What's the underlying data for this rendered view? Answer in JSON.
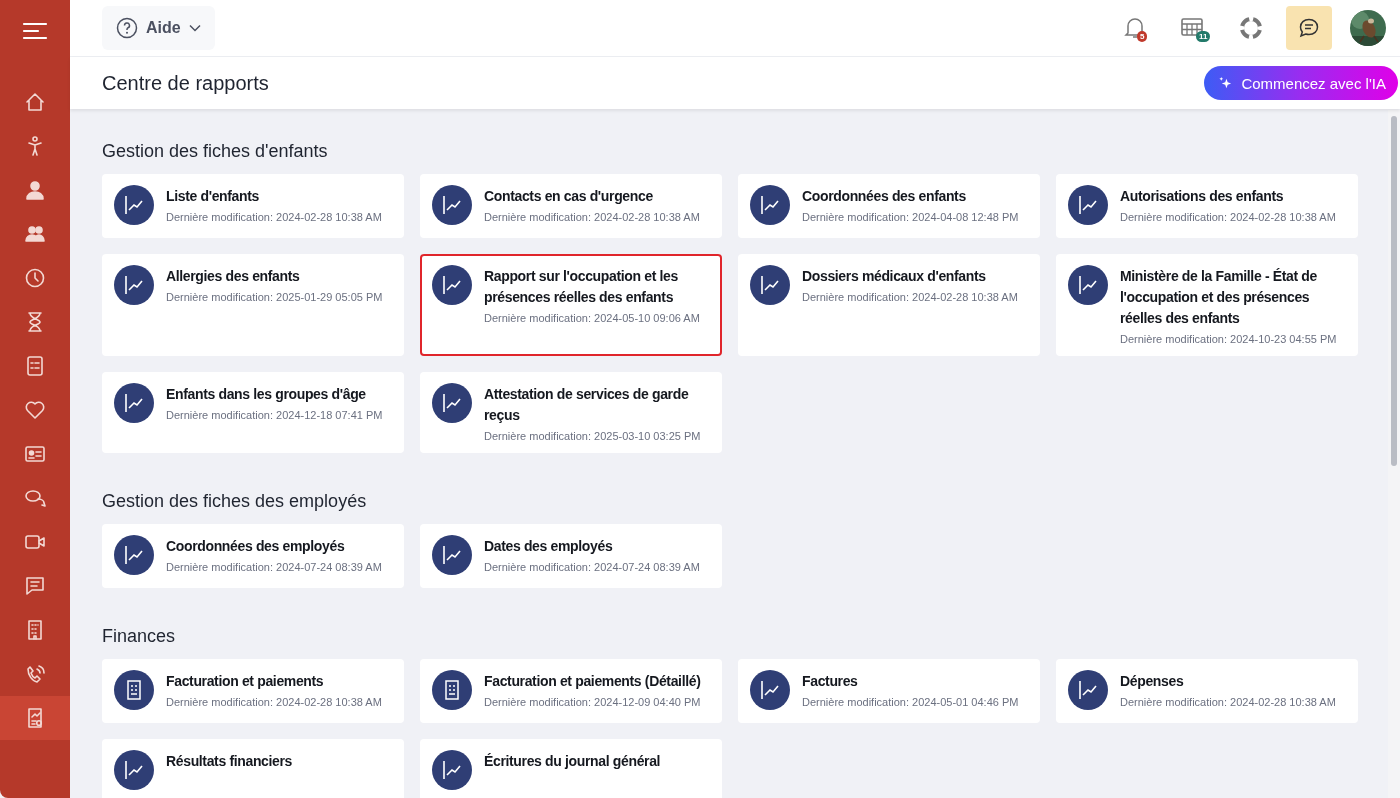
{
  "sidebar": {
    "items": [
      {
        "selected": false
      },
      {
        "selected": false
      },
      {
        "selected": false
      },
      {
        "selected": false
      },
      {
        "selected": false
      },
      {
        "selected": false
      },
      {
        "selected": false
      },
      {
        "selected": false
      },
      {
        "selected": false
      },
      {
        "selected": false
      },
      {
        "selected": false
      },
      {
        "selected": false
      },
      {
        "selected": false
      },
      {
        "selected": false
      },
      {
        "selected": true
      }
    ]
  },
  "topbar": {
    "help_label": "Aide",
    "notifications_badge": "5",
    "schedule_badge": "11",
    "chat_active": true
  },
  "page_title": "Centre de rapports",
  "ai_button": "Commencez avec l'IA",
  "sections": [
    {
      "title": "Gestion des fiches d'enfants",
      "cards": [
        {
          "title": "Liste d'enfants",
          "meta": "Dernière modification: 2024-02-28 10:38 AM",
          "kind": "chart",
          "highlighted": false
        },
        {
          "title": "Contacts en cas d'urgence",
          "meta": "Dernière modification: 2024-02-28 10:38 AM",
          "kind": "chart",
          "highlighted": false
        },
        {
          "title": "Coordonnées des enfants",
          "meta": "Dernière modification: 2024-04-08 12:48 PM",
          "kind": "chart",
          "highlighted": false
        },
        {
          "title": "Autorisations des enfants",
          "meta": "Dernière modification: 2024-02-28 10:38 AM",
          "kind": "chart",
          "highlighted": false
        },
        {
          "title": "Allergies des enfants",
          "meta": "Dernière modification: 2025-01-29 05:05 PM",
          "kind": "chart",
          "highlighted": false
        },
        {
          "title": "Rapport sur l'occupation et les présences réelles des enfants",
          "meta": "Dernière modification: 2024-05-10 09:06 AM",
          "kind": "chart",
          "highlighted": true
        },
        {
          "title": "Dossiers médicaux d'enfants",
          "meta": "Dernière modification: 2024-02-28 10:38 AM",
          "kind": "chart",
          "highlighted": false
        },
        {
          "title": "Ministère de la Famille - État de l'occupation et des présences réelles des enfants",
          "meta": "Dernière modification: 2024-10-23 04:55 PM",
          "kind": "chart",
          "highlighted": false
        },
        {
          "title": "Enfants dans les groupes d'âge",
          "meta": "Dernière modification: 2024-12-18 07:41 PM",
          "kind": "chart",
          "highlighted": false
        },
        {
          "title": "Attestation de services de garde reçus",
          "meta": "Dernière modification: 2025-03-10 03:25 PM",
          "kind": "chart",
          "highlighted": false
        }
      ]
    },
    {
      "title": "Gestion des fiches des employés",
      "cards": [
        {
          "title": "Coordonnées des employés",
          "meta": "Dernière modification: 2024-07-24 08:39 AM",
          "kind": "chart",
          "highlighted": false
        },
        {
          "title": "Dates des employés",
          "meta": "Dernière modification: 2024-07-24 08:39 AM",
          "kind": "chart",
          "highlighted": false
        }
      ]
    },
    {
      "title": "Finances",
      "cards": [
        {
          "title": "Facturation et paiements",
          "meta": "Dernière modification: 2024-02-28 10:38 AM",
          "kind": "invoice",
          "highlighted": false
        },
        {
          "title": "Facturation et paiements (Détaillé)",
          "meta": "Dernière modification: 2024-12-09 04:40 PM",
          "kind": "invoice",
          "highlighted": false
        },
        {
          "title": "Factures",
          "meta": "Dernière modification: 2024-05-01 04:46 PM",
          "kind": "chart",
          "highlighted": false
        },
        {
          "title": "Dépenses",
          "meta": "Dernière modification: 2024-02-28 10:38 AM",
          "kind": "chart",
          "highlighted": false
        },
        {
          "title": "Résultats financiers",
          "kind": "chart",
          "highlighted": false
        },
        {
          "title": "Écritures du journal général",
          "kind": "chart",
          "highlighted": false
        }
      ]
    }
  ]
}
